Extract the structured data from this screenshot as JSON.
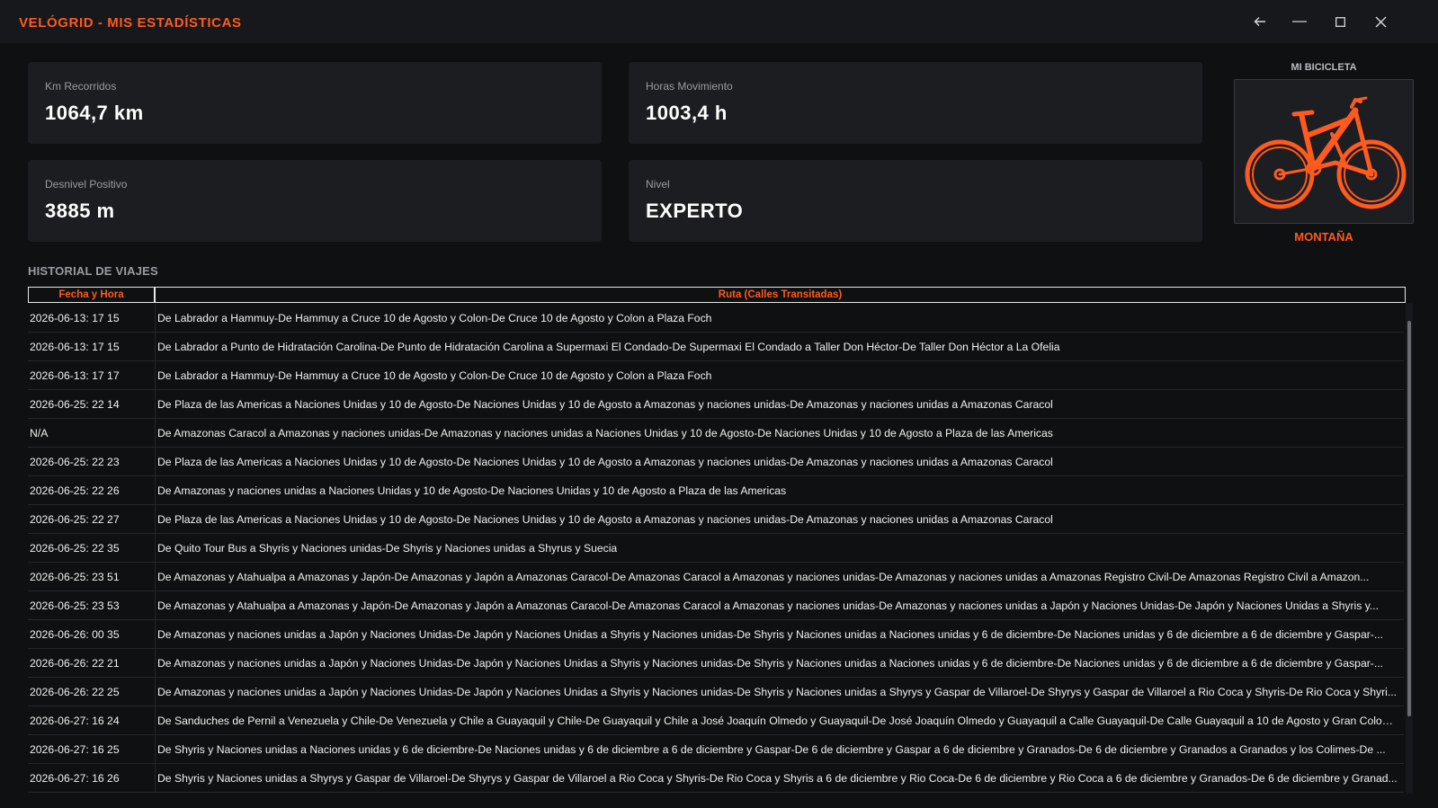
{
  "app": {
    "title": "VELÓGRID - MIS ESTADÍSTICAS",
    "icons": {
      "back": "back-arrow-icon",
      "minimize": "minimize-icon",
      "maximize": "maximize-icon",
      "close": "close-icon"
    }
  },
  "stats": {
    "km": {
      "label": "Km Recorridos",
      "value": "1064,7 km"
    },
    "hours": {
      "label": "Horas Movimiento",
      "value": "1003,4 h"
    },
    "elevation": {
      "label": "Desnivel Positivo",
      "value": "3885 m"
    },
    "level": {
      "label": "Nivel",
      "value": "EXPERTO"
    }
  },
  "bike": {
    "title": "MI BICICLETA",
    "type": "MONTAÑA",
    "icon": "mountain-bike-icon",
    "color": "#ff5a1f"
  },
  "history": {
    "title": "HISTORIAL DE VIAJES",
    "columns": {
      "date": "Fecha y Hora",
      "route": "Ruta (Calles Transitadas)"
    },
    "rows": [
      {
        "date": "2026-06-13: 17 15",
        "route": "De Labrador a Hammuy-De Hammuy a Cruce 10 de Agosto y Colon-De Cruce 10 de Agosto y Colon a Plaza Foch"
      },
      {
        "date": "2026-06-13: 17 15",
        "route": "De Labrador a Punto de Hidratación Carolina-De Punto de Hidratación Carolina a Supermaxi El Condado-De Supermaxi El Condado a Taller Don Héctor-De Taller Don Héctor a La Ofelia"
      },
      {
        "date": "2026-06-13: 17 17",
        "route": "De Labrador a Hammuy-De Hammuy a Cruce 10 de Agosto y Colon-De Cruce 10 de Agosto y Colon a Plaza Foch"
      },
      {
        "date": "2026-06-25: 22 14",
        "route": "De Plaza de las Americas a Naciones Unidas y 10 de Agosto-De Naciones Unidas y 10 de Agosto a Amazonas y naciones unidas-De Amazonas y naciones unidas a Amazonas   Caracol"
      },
      {
        "date": "N/A",
        "route": "De Amazonas   Caracol a Amazonas y naciones unidas-De Amazonas y naciones unidas a Naciones Unidas y 10 de Agosto-De Naciones Unidas y 10 de Agosto a Plaza de las Americas"
      },
      {
        "date": "2026-06-25: 22 23",
        "route": "De Plaza de las Americas a Naciones Unidas y 10 de Agosto-De Naciones Unidas y 10 de Agosto a Amazonas y naciones unidas-De Amazonas y naciones unidas a Amazonas   Caracol"
      },
      {
        "date": "2026-06-25: 22 26",
        "route": "De Amazonas y naciones unidas a Naciones Unidas y 10 de Agosto-De Naciones Unidas y 10 de Agosto a Plaza de las Americas"
      },
      {
        "date": "2026-06-25: 22 27",
        "route": "De Plaza de las Americas a Naciones Unidas y 10 de Agosto-De Naciones Unidas y 10 de Agosto a Amazonas y naciones unidas-De Amazonas y naciones unidas a Amazonas   Caracol"
      },
      {
        "date": "2026-06-25: 22 35",
        "route": "De Quito Tour Bus a Shyris y Naciones unidas-De Shyris y Naciones unidas a Shyrus y Suecia"
      },
      {
        "date": "2026-06-25: 23 51",
        "route": "De Amazonas y Atahualpa a Amazonas y Japón-De Amazonas y Japón a Amazonas   Caracol-De Amazonas   Caracol a Amazonas y naciones unidas-De Amazonas y naciones unidas a Amazonas   Registro Civil-De Amazonas   Registro Civil a Amazon..."
      },
      {
        "date": "2026-06-25: 23 53",
        "route": "De Amazonas y Atahualpa a Amazonas y Japón-De Amazonas y Japón a Amazonas   Caracol-De Amazonas   Caracol a Amazonas y naciones unidas-De Amazonas y naciones unidas a Japón y Naciones Unidas-De Japón y Naciones Unidas a Shyris y..."
      },
      {
        "date": "2026-06-26: 00 35",
        "route": "De Amazonas y naciones unidas a Japón y Naciones Unidas-De Japón y Naciones Unidas a Shyris y Naciones unidas-De Shyris y Naciones unidas a Naciones unidas y 6 de diciembre-De Naciones unidas y 6 de diciembre a 6 de diciembre y Gaspar-..."
      },
      {
        "date": "2026-06-26: 22 21",
        "route": "De Amazonas y naciones unidas a Japón y Naciones Unidas-De Japón y Naciones Unidas a Shyris y Naciones unidas-De Shyris y Naciones unidas a Naciones unidas y 6 de diciembre-De Naciones unidas y 6 de diciembre a 6 de diciembre y Gaspar-..."
      },
      {
        "date": "2026-06-26: 22 25",
        "route": "De Amazonas y naciones unidas a Japón y Naciones Unidas-De Japón y Naciones Unidas a Shyris y Naciones unidas-De Shyris y Naciones unidas a Shyrys y Gaspar de Villaroel-De Shyrys y Gaspar de Villaroel a Rio Coca y Shyris-De Rio Coca y Shyri..."
      },
      {
        "date": "2026-06-27: 16 24",
        "route": "De Sanduches de Pernil a Venezuela y Chile-De Venezuela y Chile a Guayaquil y Chile-De Guayaquil y Chile a José Joaquín Olmedo y Guayaquil-De José Joaquín Olmedo y Guayaquil a Calle Guayaquil-De Calle Guayaquil a 10 de Agosto y Gran Colom..."
      },
      {
        "date": "2026-06-27: 16 25",
        "route": "De Shyris y Naciones unidas a Naciones unidas y 6 de diciembre-De Naciones unidas y 6 de diciembre a 6 de diciembre y Gaspar-De 6 de diciembre y Gaspar a 6 de diciembre y Granados-De 6 de diciembre y Granados a Granados y los Colimes-De ..."
      },
      {
        "date": "2026-06-27: 16 26",
        "route": "De Shyris y Naciones unidas a Shyrys y Gaspar de Villaroel-De Shyrys y Gaspar de Villaroel a Rio Coca y Shyris-De Rio Coca y Shyris a 6 de diciembre y Rio Coca-De 6 de diciembre y Rio Coca a 6 de diciembre y Granados-De 6 de diciembre y Granad..."
      }
    ]
  }
}
